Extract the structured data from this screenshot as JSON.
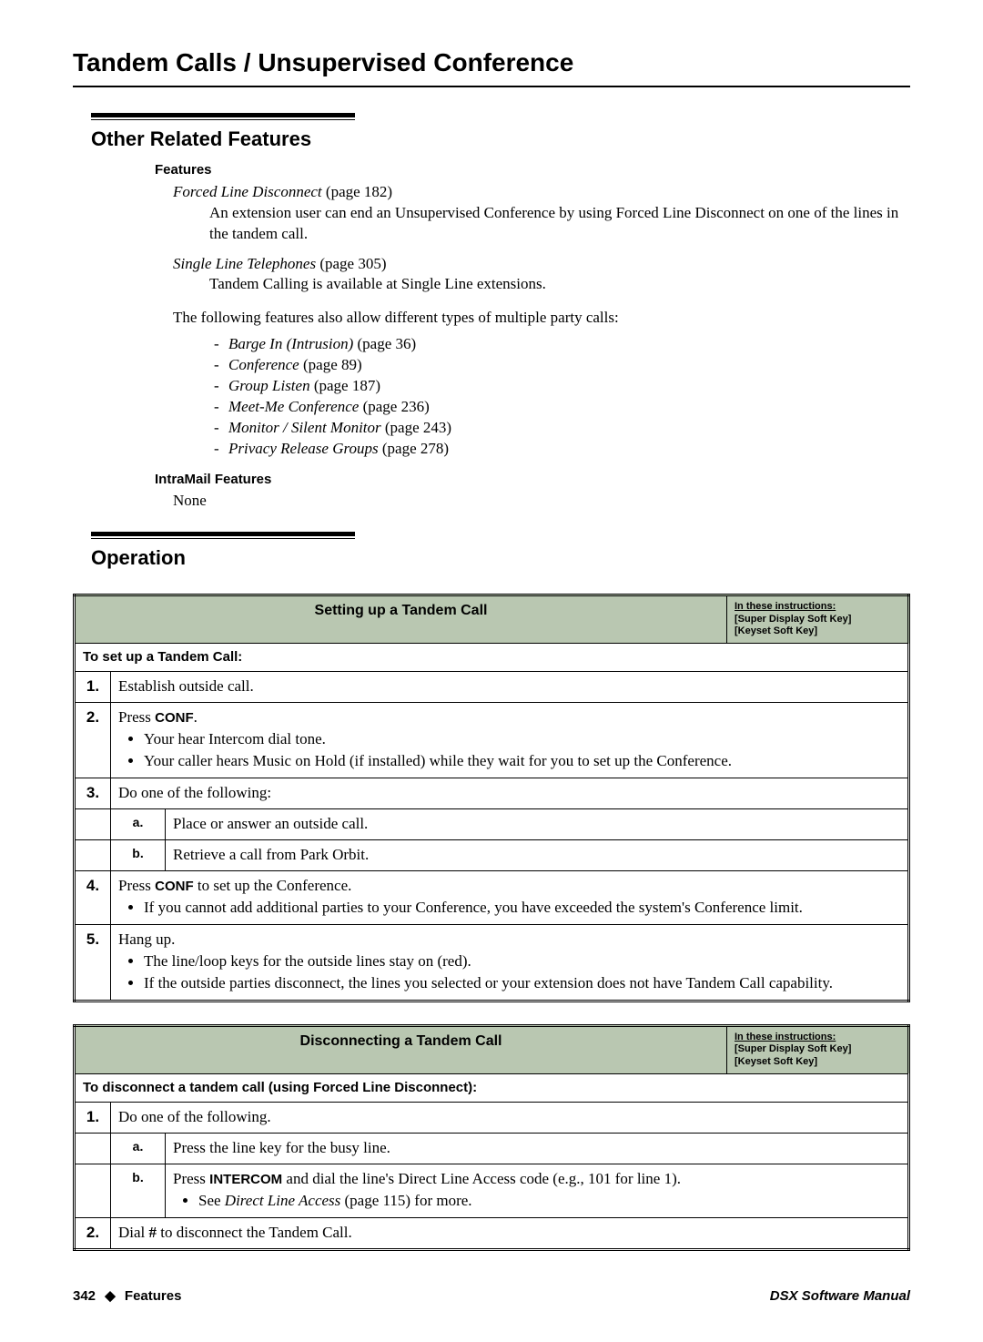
{
  "page_title": "Tandem Calls / Unsupervised Conference",
  "section1": {
    "title": "Other Related Features",
    "features_label": "Features",
    "f1_ref": "Forced Line Disconnect",
    "f1_page": " (page 182)",
    "f1_desc": "An extension user can end an Unsupervised Conference by using Forced Line Disconnect on one of the lines in the tandem call.",
    "f2_ref": "Single Line Telephones",
    "f2_page": " (page 305)",
    "f2_desc": "Tandem Calling is available at Single Line extensions.",
    "para": "The following features also allow different types of multiple party calls:",
    "list": [
      {
        "name": "Barge In (Intrusion)",
        "page": " (page 36)"
      },
      {
        "name": "Conference",
        "page": " (page 89)"
      },
      {
        "name": "Group Listen",
        "page": " (page 187)"
      },
      {
        "name": "Meet-Me Conference",
        "page": " (page 236)"
      },
      {
        "name": "Monitor / Silent Monitor",
        "page": " (page 243)"
      },
      {
        "name": "Privacy Release Groups",
        "page": " (page 278)"
      }
    ],
    "intramail_label": "IntraMail Features",
    "intramail_none": "None"
  },
  "section2": {
    "title": "Operation"
  },
  "table1": {
    "title": "Setting up a Tandem Call",
    "note_l1": "In these instructions:",
    "note_l2": "[Super Display Soft Key]",
    "note_l3": "[Keyset Soft Key]",
    "subhdr": "To set up a Tandem Call:",
    "s1": "Establish outside call.",
    "s2_a": "Press ",
    "s2_b": "CONF",
    "s2_c": ".",
    "s2_bul1": "Your hear Intercom dial tone.",
    "s2_bul2": "Your caller hears Music on Hold (if installed) while they wait for you to set up the Conference.",
    "s3": "Do one of the following:",
    "s3a": "Place or answer an outside call.",
    "s3b": "Retrieve a call from Park Orbit.",
    "s4_a": "Press ",
    "s4_b": "CONF",
    "s4_c": " to set up the Conference.",
    "s4_bul1": "If you cannot add additional parties to your Conference, you have exceeded the system's Conference limit.",
    "s5": "Hang up.",
    "s5_bul1": "The line/loop keys for the outside lines stay on (red).",
    "s5_bul2": "If the outside parties disconnect, the lines you selected or your extension does not have Tandem Call capability."
  },
  "table2": {
    "title": "Disconnecting a Tandem Call",
    "note_l1": "In these instructions:",
    "note_l2": "[Super Display Soft Key]",
    "note_l3": "[Keyset Soft Key]",
    "subhdr": "To disconnect a tandem call (using Forced Line Disconnect):",
    "s1": "Do one of the following.",
    "s1a": "Press the line key for the busy line.",
    "s1b_a": "Press ",
    "s1b_b": "INTERCOM",
    "s1b_c": " and dial the line's Direct Line Access code (e.g., 101 for line 1).",
    "s1b_bul_a": "See ",
    "s1b_bul_b": "Direct Line Access",
    "s1b_bul_c": " (page 115) for more.",
    "s2_a": "Dial ",
    "s2_b": "#",
    "s2_c": " to disconnect the Tandem Call."
  },
  "footer": {
    "page_num": "342",
    "diamond": "◆",
    "section": "Features",
    "manual": "DSX Software Manual"
  }
}
